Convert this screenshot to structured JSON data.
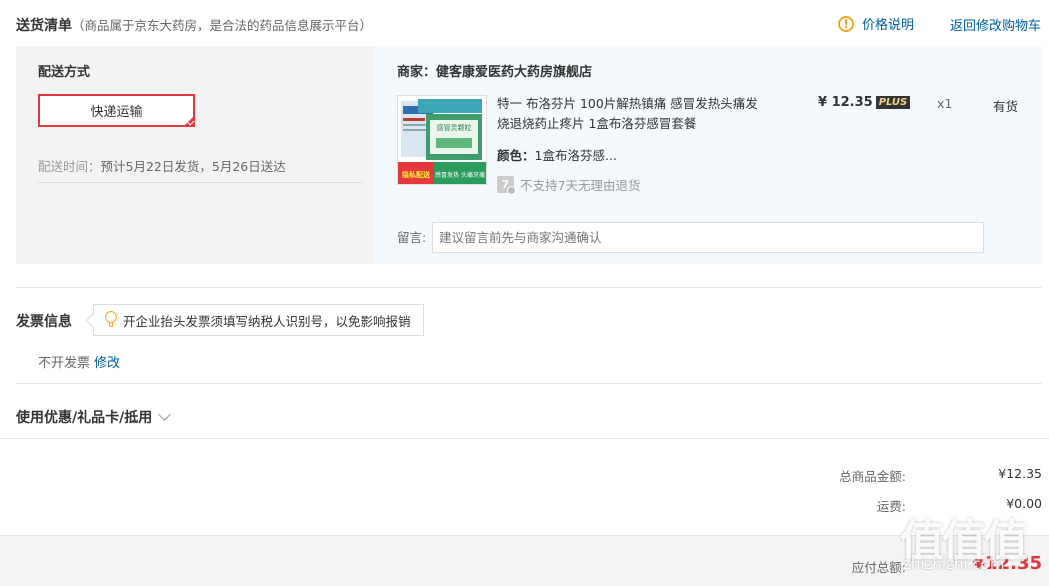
{
  "header": {
    "title": "送货清单",
    "subtitle": "（商品属于京东大药房，是合法的药品信息展示平台）",
    "price_note": "价格说明",
    "return_cart": "返回修改购物车"
  },
  "shipping": {
    "label": "配送方式",
    "option": "快递运输",
    "time_label": "配送时间：",
    "time_value": "预计5月22日发货，5月26日送达"
  },
  "merchant": {
    "label": "商家：",
    "name": "健客康爱医药大药房旗舰店"
  },
  "product": {
    "name": "特一 布洛芬片 100片解热镇痛 感冒发热头痛发烧退烧药止疼片 1盒布洛芬感冒套餐",
    "price": "¥ 12.35",
    "plus_badge": "PLUS",
    "qty": "x1",
    "stock": "有货",
    "color_label": "颜色：",
    "color_value": "1盒布洛芬感...",
    "return_icon": "7",
    "no_return": "不支持7天无理由退货",
    "img_box_text": "感冒灵颗粒",
    "img_banner_1": "隐私配送",
    "img_banner_2": "感冒发热 头痛牙痛"
  },
  "remark": {
    "label": "留言:",
    "placeholder": "建议留言前先与商家沟通确认"
  },
  "invoice": {
    "title": "发票信息",
    "tip": "开企业抬头发票须填写纳税人识别号，以免影响报销",
    "value": "不开发票",
    "edit": "修改"
  },
  "coupon": {
    "label": "使用优惠/礼品卡/抵用"
  },
  "summary": {
    "total_label": "总商品金额:",
    "total_value": "¥12.35",
    "freight_label": "运费:",
    "freight_value": "¥0.00",
    "pay_label": "应付总额:",
    "pay_value": "¥12.35"
  },
  "watermark": {
    "main": "值值值",
    "site": "zhizhizhi.com"
  },
  "colors": {
    "accent_red": "#e4393c",
    "link_blue": "#005ea7",
    "warn_orange": "#f5a623"
  }
}
